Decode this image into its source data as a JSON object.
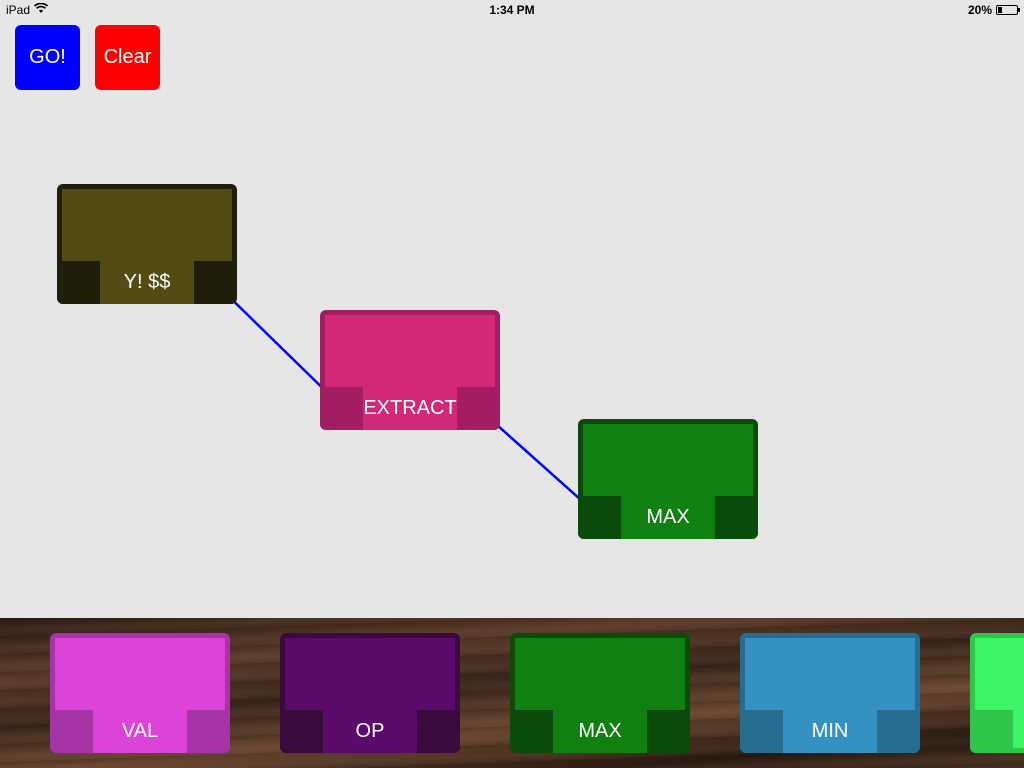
{
  "status_bar": {
    "device": "iPad",
    "time": "1:34 PM",
    "battery": "20%",
    "icons": [
      "wifi-icon",
      "battery-icon"
    ]
  },
  "toolbar": {
    "go_label": "GO!",
    "clear_label": "Clear",
    "go_color": "#0000ff",
    "clear_color": "#ff0000"
  },
  "canvas": {
    "nodes": [
      {
        "label": "Y! $$",
        "frame_color": "#1f1e0a",
        "body_color": "#524c14"
      },
      {
        "label": "EXTRACT",
        "frame_color": "#a21d62",
        "body_color": "#d12878"
      },
      {
        "label": "MAX",
        "frame_color": "#0a4a0a",
        "body_color": "#108010"
      }
    ],
    "wire_color": "#0000ff"
  },
  "tray": {
    "blocks": [
      {
        "label": "VAL",
        "frame_color": "#a734a7",
        "body_color": "#db44d6"
      },
      {
        "label": "OP",
        "frame_color": "#3a0a3c",
        "body_color": "#5a0a6a"
      },
      {
        "label": "MAX",
        "frame_color": "#0a4a0a",
        "body_color": "#108010"
      },
      {
        "label": "MIN",
        "frame_color": "#256d91",
        "body_color": "#3491c2"
      },
      {
        "label": "",
        "frame_color": "#2fc44a",
        "body_color": "#3cf566"
      }
    ]
  }
}
